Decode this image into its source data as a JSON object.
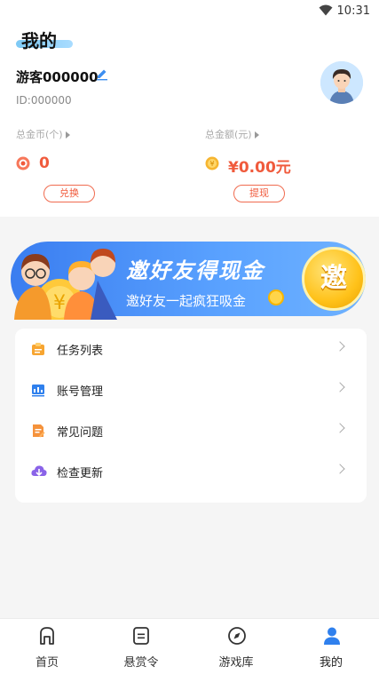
{
  "status_bar": {
    "time": "10:31"
  },
  "header": {
    "title": "我的",
    "username": "游客000000",
    "user_id": "ID:000000",
    "coins_label": "总金币(个)",
    "coins_value": "0",
    "amount_label": "总金额(元)",
    "amount_value": "¥0.00元",
    "exchange_button": "兑换",
    "withdraw_button": "提现"
  },
  "banner": {
    "title": "邀好友得现金",
    "subtitle": "邀好友一起疯狂吸金",
    "badge": "邀"
  },
  "menu": {
    "items": [
      {
        "label": "任务列表",
        "icon": "task-list-icon"
      },
      {
        "label": "账号管理",
        "icon": "account-management-icon"
      },
      {
        "label": "常见问题",
        "icon": "faq-icon"
      },
      {
        "label": "检查更新",
        "icon": "check-update-icon"
      }
    ]
  },
  "tabbar": {
    "tabs": [
      {
        "label": "首页",
        "icon": "home-icon"
      },
      {
        "label": "悬赏令",
        "icon": "bounty-icon"
      },
      {
        "label": "游戏库",
        "icon": "compass-icon"
      },
      {
        "label": "我的",
        "icon": "profile-icon"
      }
    ],
    "active_index": 3
  },
  "colors": {
    "accent": "#f05a3c",
    "blue": "#3a7df0",
    "active_tab": "#2f80ed"
  }
}
